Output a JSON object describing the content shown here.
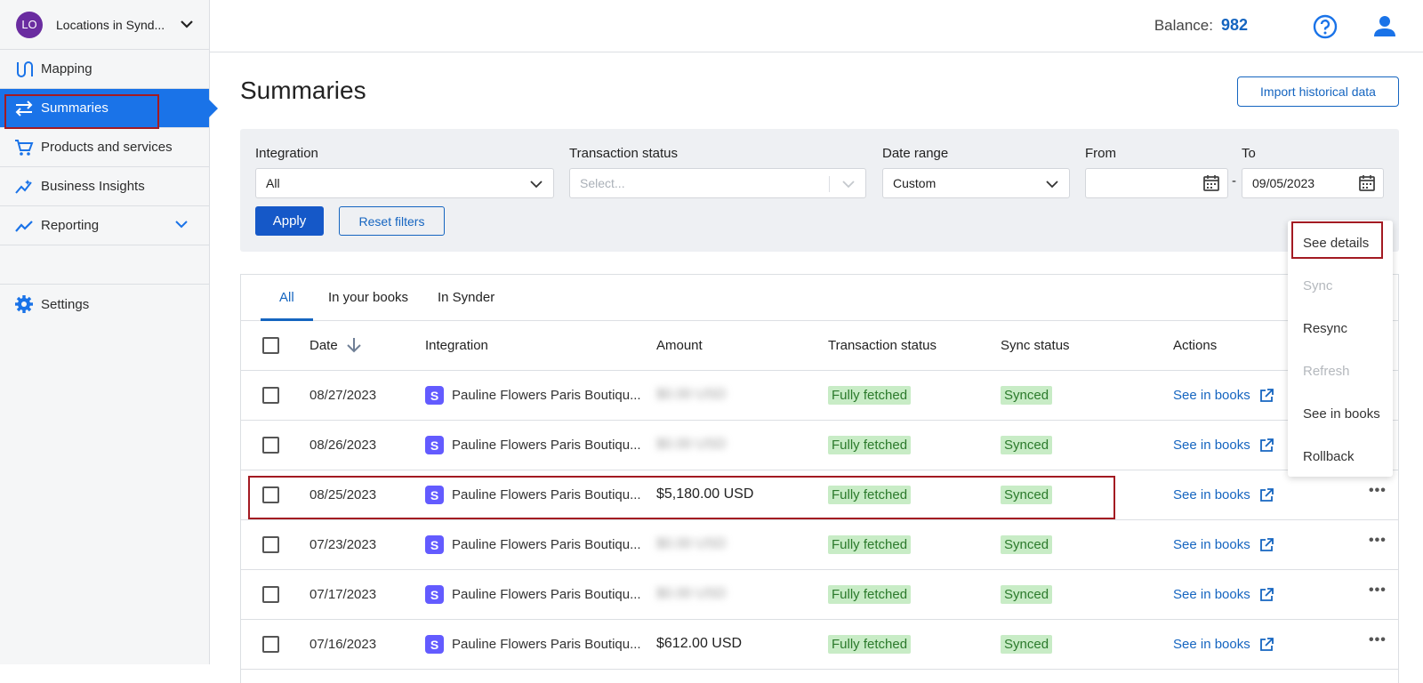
{
  "org": {
    "initials": "LO",
    "name": "Locations in Synd..."
  },
  "sidebar": {
    "items": [
      {
        "label": "Mapping"
      },
      {
        "label": "Summaries"
      },
      {
        "label": "Products and services"
      },
      {
        "label": "Business Insights"
      },
      {
        "label": "Reporting"
      }
    ],
    "settings": "Settings"
  },
  "topbar": {
    "balance_label": "Balance:",
    "balance_value": "982"
  },
  "page": {
    "title": "Summaries",
    "import_button": "Import historical data"
  },
  "filters": {
    "integration_label": "Integration",
    "integration_value": "All",
    "status_label": "Transaction status",
    "status_placeholder": "Select...",
    "date_range_label": "Date range",
    "date_range_value": "Custom",
    "from_label": "From",
    "from_value": "",
    "to_label": "To",
    "to_value": "09/05/2023",
    "dash": "-",
    "apply": "Apply",
    "reset": "Reset filters"
  },
  "tabs": [
    {
      "label": "All"
    },
    {
      "label": "In your books"
    },
    {
      "label": "In Synder"
    }
  ],
  "table": {
    "headers": {
      "date": "Date",
      "integration": "Integration",
      "amount": "Amount",
      "status": "Transaction status",
      "sync": "Sync status",
      "actions": "Actions"
    },
    "rows": [
      {
        "date": "08/27/2023",
        "integration": "Pauline Flowers Paris Boutiqu...",
        "amount": "$0.00 USD",
        "amount_blurred": true,
        "status": "Fully fetched",
        "sync": "Synced",
        "action": "See in books"
      },
      {
        "date": "08/26/2023",
        "integration": "Pauline Flowers Paris Boutiqu...",
        "amount": "$0.00 USD",
        "amount_blurred": true,
        "status": "Fully fetched",
        "sync": "Synced",
        "action": "See in books"
      },
      {
        "date": "08/25/2023",
        "integration": "Pauline Flowers Paris Boutiqu...",
        "amount": "$5,180.00 USD",
        "amount_blurred": false,
        "status": "Fully fetched",
        "sync": "Synced",
        "action": "See in books"
      },
      {
        "date": "07/23/2023",
        "integration": "Pauline Flowers Paris Boutiqu...",
        "amount": "$0.00 USD",
        "amount_blurred": true,
        "status": "Fully fetched",
        "sync": "Synced",
        "action": "See in books"
      },
      {
        "date": "07/17/2023",
        "integration": "Pauline Flowers Paris Boutiqu...",
        "amount": "$0.00 USD",
        "amount_blurred": true,
        "status": "Fully fetched",
        "sync": "Synced",
        "action": "See in books"
      },
      {
        "date": "07/16/2023",
        "integration": "Pauline Flowers Paris Boutiqu...",
        "amount": "$612.00 USD",
        "amount_blurred": false,
        "status": "Fully fetched",
        "sync": "Synced",
        "action": "See in books"
      }
    ],
    "integration_icon_letter": "S"
  },
  "menu": {
    "items": [
      {
        "label": "See details",
        "disabled": false
      },
      {
        "label": "Sync",
        "disabled": true
      },
      {
        "label": "Resync",
        "disabled": false
      },
      {
        "label": "Refresh",
        "disabled": true
      },
      {
        "label": "See in books",
        "disabled": false
      },
      {
        "label": "Rollback",
        "disabled": false
      }
    ]
  },
  "colors": {
    "accent": "#1a73e8",
    "link": "#1565c0",
    "highlight": "#a31a22",
    "badge_bg": "#c8ecc6",
    "badge_text": "#2b7a2b"
  }
}
